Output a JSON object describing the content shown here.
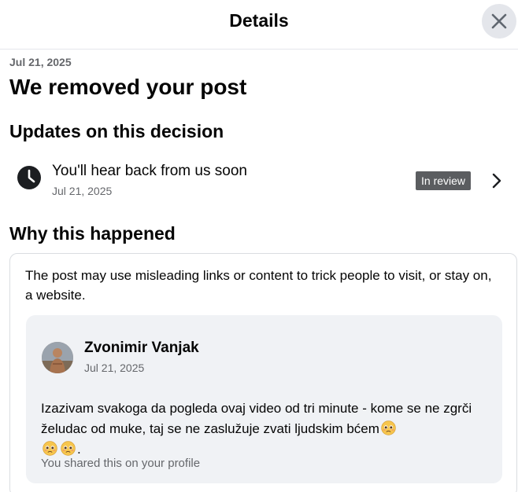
{
  "header": {
    "title": "Details",
    "close_icon": "close-icon"
  },
  "notice": {
    "date": "Jul 21, 2025",
    "heading": "We removed your post"
  },
  "updates": {
    "heading": "Updates on this decision",
    "items": [
      {
        "icon": "clock-icon",
        "title": "You'll hear back from us soon",
        "date": "Jul 21, 2025",
        "status": "In review",
        "status_color": "#5b5d60"
      }
    ]
  },
  "why": {
    "heading": "Why this happened",
    "reason": "The post may use misleading links or content to trick people to visit, or stay on, a website.",
    "post": {
      "author": "Zvonimir Vanjak",
      "date": "Jul 21, 2025",
      "text": "Izazivam svakoga da pogleda ovaj video od tri minute - kome se ne zgrči želudac od muke, taj se ne zaslužuje zvati ljudskim bćem",
      "trailing_punctuation": ".",
      "emoji_icon": "pleading-face-emoji",
      "footer": "You shared this on your profile"
    }
  },
  "colors": {
    "text_primary": "#050505",
    "text_secondary": "#65676b",
    "post_background": "#f0f2f5",
    "close_button_background": "#e4e6eb"
  }
}
